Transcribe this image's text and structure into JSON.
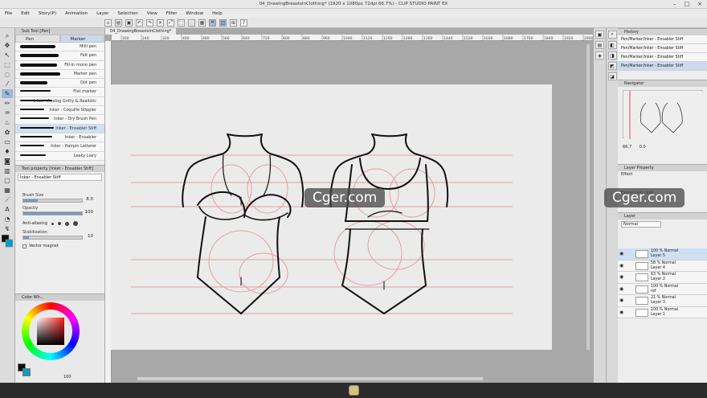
{
  "window": {
    "title": "04_DrawingBreastsInClothing* (1920 x 1080px 72dpi 66.7%) - CLIP STUDIO PAINT EX",
    "doc_tab": "04_DrawingBreastsInClothing*"
  },
  "menu": [
    "File",
    "Edit",
    "Story(P)",
    "Animation",
    "Layer",
    "Selection",
    "View",
    "Filter",
    "Window",
    "Help"
  ],
  "ruler_ticks": [
    "160",
    "240",
    "320",
    "400",
    "480",
    "560",
    "640",
    "720",
    "800",
    "880",
    "960",
    "1040",
    "1120",
    "1200",
    "1280",
    "1360",
    "1440",
    "1520",
    "1600",
    "1680",
    "1760",
    "1840",
    "1920",
    "2000"
  ],
  "subtool": {
    "header": "Sub Tool [Pen]",
    "tabs": [
      "Pen",
      "Marker"
    ],
    "brushes": [
      "Milli pen",
      "Felt pen",
      "Fill-in mono pen",
      "Marker pen",
      "Dot pen",
      "Flat marker",
      "Inker - Analog Gritty & Realistic",
      "Inker - Coquille Stippler",
      "Inker - Dry Brush Pen",
      "Inker - Ensabler Stiff",
      "Inker - Ensabler",
      "Inker - Hairpin Letterer",
      "Leaky Liary"
    ]
  },
  "tool_property": {
    "header": "Tool property [Inker - Ensabler Stiff]",
    "name": "Inker - Ensabler Stiff",
    "brush_size_label": "Brush Size",
    "brush_size_value": "8.0",
    "brush_size_fraction": 0.25,
    "opacity_label": "Opacity",
    "opacity_value": "100",
    "opacity_fraction": 1.0,
    "antialias_label": "Anti-aliasing",
    "stabilization_label": "Stabilization",
    "stabilization_value": "10",
    "stabilization_fraction": 0.1,
    "vector_magnet_label": "Vector magnet"
  },
  "color_panel": {
    "header": "Color Wh...",
    "main_color": "#111111",
    "sub_color": "#0b9ec4",
    "readout": "100"
  },
  "history": {
    "header": "History",
    "items": [
      "Pen/Marker/Inker - Ensabler Stiff",
      "Pen/Marker/Inker - Ensabler Stiff",
      "Pen/Marker/Inker - Ensabler Stiff",
      "Pen/Marker/Inker - Ensabler Stiff"
    ]
  },
  "navigator": {
    "header": "Navigator",
    "zoom": "66.7",
    "angle": "0.0"
  },
  "layer_property": {
    "header": "Layer Property",
    "effect_label": "Effect",
    "expression_label": "Expression color"
  },
  "layers": {
    "header": "Layer",
    "blend_mode": "Normal",
    "items": [
      {
        "line1": "100 % Normal",
        "line2": "Layer 5"
      },
      {
        "line1": "58 % Normal",
        "line2": "Layer 4"
      },
      {
        "line1": "63 % Normal",
        "line2": "Layer 2"
      },
      {
        "line1": "100 % Normal",
        "line2": "ref"
      },
      {
        "line1": "21 % Normal",
        "line2": "Layer 3"
      },
      {
        "line1": "100 % Normal",
        "line2": "Layer 1"
      }
    ]
  },
  "watermark": "Cger.com",
  "colors": {
    "accent": "#9db8d8",
    "selection": "#cfe0f3",
    "guide_lines": "#e4a0a0"
  }
}
